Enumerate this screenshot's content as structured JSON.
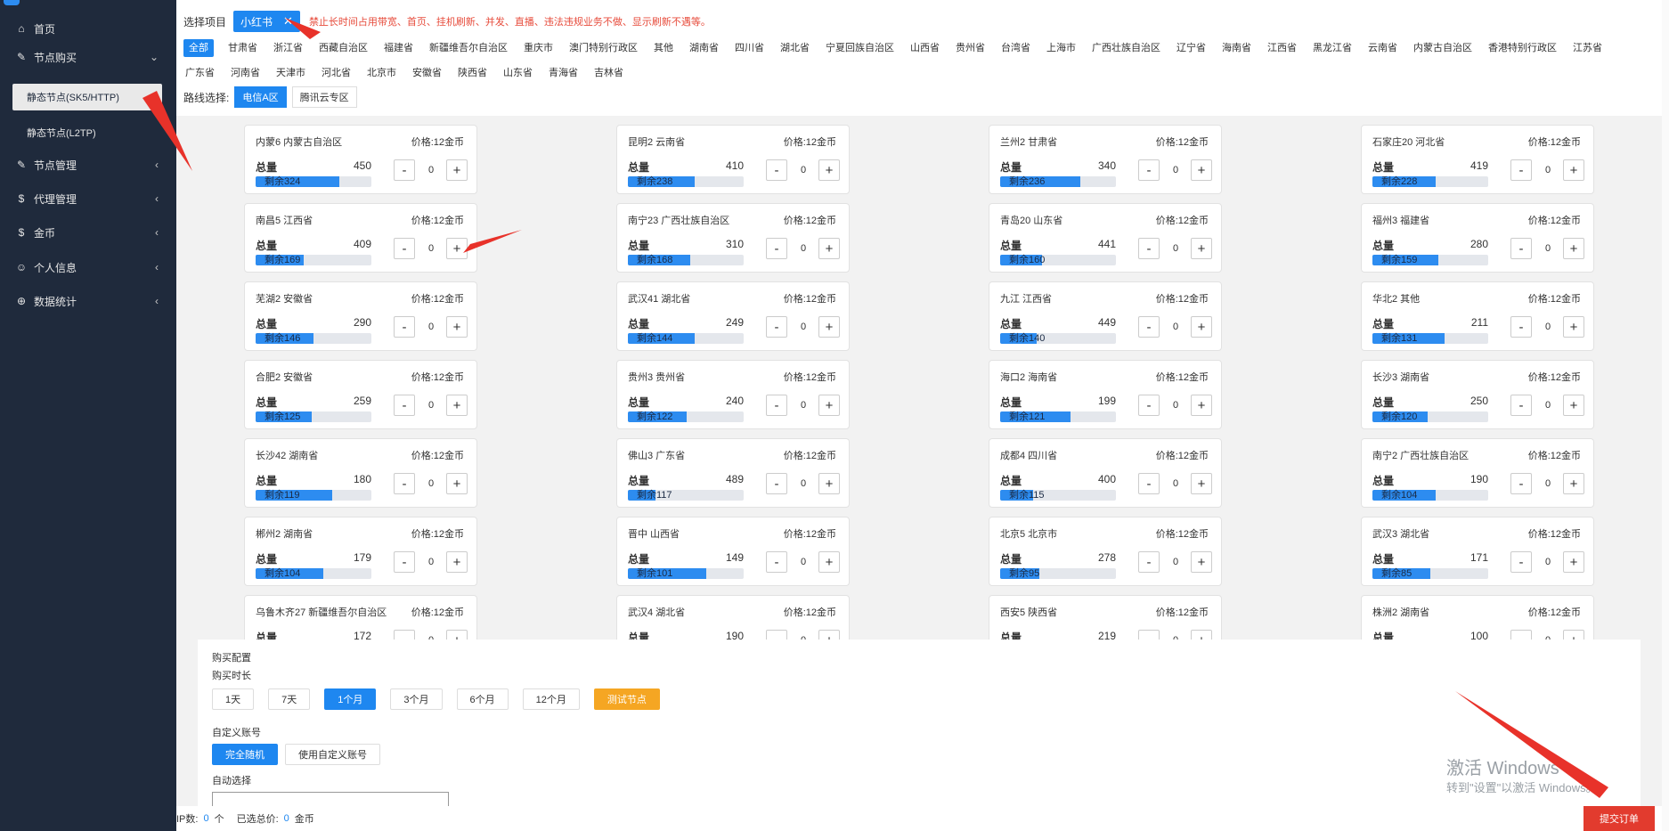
{
  "sidebar": {
    "items": [
      {
        "label": "首页",
        "icon": "home-icon",
        "glyph": "⌂"
      },
      {
        "label": "节点购买",
        "icon": "tools-icon",
        "glyph": "✎",
        "arrow": "⌄"
      },
      {
        "label": "节点管理",
        "icon": "tools-icon",
        "glyph": "✎",
        "arrow": "‹"
      },
      {
        "label": "代理管理",
        "icon": "dollar-icon",
        "glyph": "$",
        "arrow": "‹"
      },
      {
        "label": "金币",
        "icon": "dollar-icon",
        "glyph": "$",
        "arrow": "‹"
      },
      {
        "label": "个人信息",
        "icon": "user-icon",
        "glyph": "☺",
        "arrow": "‹"
      },
      {
        "label": "数据统计",
        "icon": "globe-icon",
        "glyph": "⊕",
        "arrow": "‹"
      }
    ],
    "sub_items": [
      "静态节点(SK5/HTTP)",
      "静态节点(L2TP)"
    ]
  },
  "header": {
    "select_label": "选择项目",
    "project_tag": "小红书",
    "close_glyph": "✕",
    "warning": "禁止长时间占用带宽、首页、挂机刷新、并发、直播、违法违规业务不做、显示刷新不遇等。",
    "regions": [
      "全部",
      "甘肃省",
      "浙江省",
      "西藏自治区",
      "福建省",
      "新疆维吾尔自治区",
      "重庆市",
      "澳门特别行政区",
      "其他",
      "湖南省",
      "四川省",
      "湖北省",
      "宁夏回族自治区",
      "山西省",
      "贵州省",
      "台湾省",
      "上海市",
      "广西壮族自治区",
      "辽宁省",
      "海南省",
      "江西省",
      "黑龙江省",
      "云南省",
      "内蒙古自治区",
      "香港特别行政区",
      "江苏省",
      "广东省",
      "河南省",
      "天津市",
      "河北省",
      "北京市",
      "安徽省",
      "陕西省",
      "山东省",
      "青海省",
      "吉林省"
    ],
    "line_label": "路线选择:",
    "lines": [
      "电信A区",
      "腾讯云专区"
    ]
  },
  "card_labels": {
    "total": "总量",
    "minus": "-",
    "plus": "+"
  },
  "nodes": [
    {
      "name": "内蒙6 内蒙古自治区",
      "price": "价格:12金币",
      "total": "450",
      "remain": "剩余324",
      "remain_n": 324,
      "qty": "0"
    },
    {
      "name": "昆明2 云南省",
      "price": "价格:12金币",
      "total": "410",
      "remain": "剩余238",
      "remain_n": 238,
      "qty": "0"
    },
    {
      "name": "兰州2 甘肃省",
      "price": "价格:12金币",
      "total": "340",
      "remain": "剩余236",
      "remain_n": 236,
      "qty": "0"
    },
    {
      "name": "石家庄20 河北省",
      "price": "价格:12金币",
      "total": "419",
      "remain": "剩余228",
      "remain_n": 228,
      "qty": "0"
    },
    {
      "name": "南昌5 江西省",
      "price": "价格:12金币",
      "total": "409",
      "remain": "剩余169",
      "remain_n": 169,
      "qty": "0"
    },
    {
      "name": "南宁23 广西壮族自治区",
      "price": "价格:12金币",
      "total": "310",
      "remain": "剩余168",
      "remain_n": 168,
      "qty": "0"
    },
    {
      "name": "青岛20 山东省",
      "price": "价格:12金币",
      "total": "441",
      "remain": "剩余160",
      "remain_n": 160,
      "qty": "0"
    },
    {
      "name": "福州3 福建省",
      "price": "价格:12金币",
      "total": "280",
      "remain": "剩余159",
      "remain_n": 159,
      "qty": "0"
    },
    {
      "name": "芜湖2 安徽省",
      "price": "价格:12金币",
      "total": "290",
      "remain": "剩余146",
      "remain_n": 146,
      "qty": "0"
    },
    {
      "name": "武汉41 湖北省",
      "price": "价格:12金币",
      "total": "249",
      "remain": "剩余144",
      "remain_n": 144,
      "qty": "0"
    },
    {
      "name": "九江 江西省",
      "price": "价格:12金币",
      "total": "449",
      "remain": "剩余140",
      "remain_n": 140,
      "qty": "0"
    },
    {
      "name": "华北2 其他",
      "price": "价格:12金币",
      "total": "211",
      "remain": "剩余131",
      "remain_n": 131,
      "qty": "0"
    },
    {
      "name": "合肥2 安徽省",
      "price": "价格:12金币",
      "total": "259",
      "remain": "剩余125",
      "remain_n": 125,
      "qty": "0"
    },
    {
      "name": "贵州3 贵州省",
      "price": "价格:12金币",
      "total": "240",
      "remain": "剩余122",
      "remain_n": 122,
      "qty": "0"
    },
    {
      "name": "海口2 海南省",
      "price": "价格:12金币",
      "total": "199",
      "remain": "剩余121",
      "remain_n": 121,
      "qty": "0"
    },
    {
      "name": "长沙3 湖南省",
      "price": "价格:12金币",
      "total": "250",
      "remain": "剩余120",
      "remain_n": 120,
      "qty": "0"
    },
    {
      "name": "长沙42 湖南省",
      "price": "价格:12金币",
      "total": "180",
      "remain": "剩余119",
      "remain_n": 119,
      "qty": "0"
    },
    {
      "name": "佛山3 广东省",
      "price": "价格:12金币",
      "total": "489",
      "remain": "剩余117",
      "remain_n": 117,
      "qty": "0"
    },
    {
      "name": "成都4 四川省",
      "price": "价格:12金币",
      "total": "400",
      "remain": "剩余115",
      "remain_n": 115,
      "qty": "0"
    },
    {
      "name": "南宁2 广西壮族自治区",
      "price": "价格:12金币",
      "total": "190",
      "remain": "剩余104",
      "remain_n": 104,
      "qty": "0"
    },
    {
      "name": "郴州2 湖南省",
      "price": "价格:12金币",
      "total": "179",
      "remain": "剩余104",
      "remain_n": 104,
      "qty": "0"
    },
    {
      "name": "晋中 山西省",
      "price": "价格:12金币",
      "total": "149",
      "remain": "剩余101",
      "remain_n": 101,
      "qty": "0"
    },
    {
      "name": "北京5 北京市",
      "price": "价格:12金币",
      "total": "278",
      "remain": "剩余95",
      "remain_n": 95,
      "qty": "0"
    },
    {
      "name": "武汉3 湖北省",
      "price": "价格:12金币",
      "total": "171",
      "remain": "剩余85",
      "remain_n": 85,
      "qty": "0"
    },
    {
      "name": "乌鲁木齐27 新疆维吾尔自治区",
      "price": "价格:12金币",
      "total": "172",
      "remain": "",
      "remain_n": 0,
      "qty": "0"
    },
    {
      "name": "武汉4 湖北省",
      "price": "价格:12金币",
      "total": "190",
      "remain": "",
      "remain_n": 0,
      "qty": "0"
    },
    {
      "name": "西安5 陕西省",
      "price": "价格:12金币",
      "total": "219",
      "remain": "",
      "remain_n": 0,
      "qty": "0"
    },
    {
      "name": "株洲2 湖南省",
      "price": "价格:12金币",
      "total": "100",
      "remain": "",
      "remain_n": 0,
      "qty": "0"
    }
  ],
  "config": {
    "title": "购买配置",
    "duration_label": "购买时长",
    "durations": [
      "1天",
      "7天",
      "1个月",
      "3个月",
      "6个月",
      "12个月"
    ],
    "test_button": "测试节点",
    "account_label": "自定义账号",
    "accounts": [
      "完全随机",
      "使用自定义账号"
    ],
    "auto_label": "自动选择"
  },
  "footer": {
    "ip_label": "IP数:",
    "ip_count": "0",
    "ip_unit": "个",
    "price_label": "已选总价:",
    "price_value": "0",
    "price_unit": "金币",
    "submit": "提交订单"
  },
  "watermark": {
    "line1": "激活 Windows",
    "line2": "转到\"设置\"以激活 Windows。"
  },
  "colors": {
    "accent": "#1e87f0",
    "sidebar": "#1f2a3c",
    "warning": "#e74c3c",
    "submit": "#e23b2e",
    "test": "#f5a623",
    "annotation_arrow": "#e8322a"
  }
}
